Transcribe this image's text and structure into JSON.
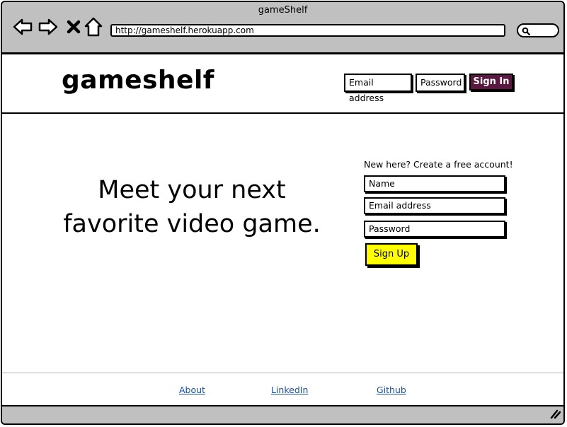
{
  "window": {
    "title": "gameShelf",
    "url": "http://gameshelf.herokuapp.com"
  },
  "header": {
    "logo": "gameshelf",
    "email_placeholder": "Email address",
    "password_placeholder": "Password",
    "signin_label": "Sign In"
  },
  "hero": {
    "line1": "Meet your next",
    "line2": "favorite video game."
  },
  "signup": {
    "prompt": "New here? Create a free account!",
    "name_placeholder": "Name",
    "email_placeholder": "Email address",
    "password_placeholder": "Password",
    "button_label": "Sign Up"
  },
  "footer": {
    "links": [
      "About",
      "LinkedIn",
      "Github"
    ]
  },
  "colors": {
    "signin_bg": "#5a1740",
    "signup_bg": "#ffff00",
    "link": "#1a4f9c",
    "chrome": "#c0c0c0"
  },
  "icons": [
    "back-arrow-icon",
    "forward-arrow-icon",
    "stop-icon",
    "home-icon",
    "search-icon",
    "resize-grip-icon"
  ]
}
